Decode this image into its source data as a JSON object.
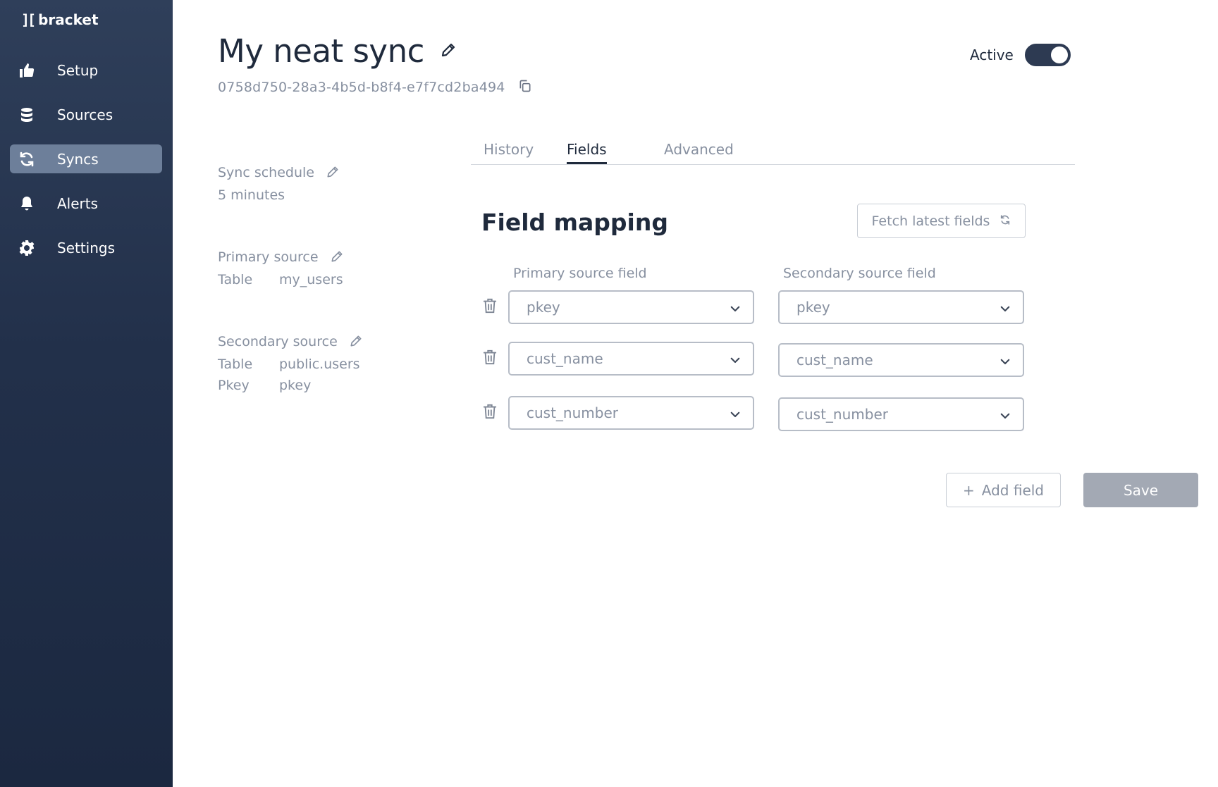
{
  "app": {
    "logo_mark": "][",
    "logo_text": "bracket"
  },
  "sidebar": {
    "items": [
      {
        "label": "Setup",
        "icon": "thumbs-up-icon",
        "active": false
      },
      {
        "label": "Sources",
        "icon": "database-icon",
        "active": false
      },
      {
        "label": "Syncs",
        "icon": "sync-icon",
        "active": true
      },
      {
        "label": "Alerts",
        "icon": "bell-icon",
        "active": false
      },
      {
        "label": "Settings",
        "icon": "gear-icon",
        "active": false
      }
    ]
  },
  "header": {
    "title": "My neat sync",
    "sync_id": "0758d750-28a3-4b5d-b8f4-e7f7cd2ba494",
    "active_label": "Active",
    "active": true
  },
  "details": {
    "schedule_label": "Sync schedule",
    "schedule_value": "5 minutes",
    "primary_label": "Primary source",
    "primary_table_key": "Table",
    "primary_table_value": "my_users",
    "secondary_label": "Secondary source",
    "secondary_table_key": "Table",
    "secondary_table_value": "public.users",
    "secondary_pkey_key": "Pkey",
    "secondary_pkey_value": "pkey"
  },
  "tabs": [
    {
      "label": "History",
      "active": false
    },
    {
      "label": "Fields",
      "active": true
    },
    {
      "label": "Advanced",
      "active": false
    }
  ],
  "field_mapping": {
    "title": "Field mapping",
    "fetch_label": "Fetch latest fields",
    "primary_header": "Primary source field",
    "secondary_header": "Secondary source field",
    "rows": [
      {
        "primary": "pkey",
        "secondary": "pkey"
      },
      {
        "primary": "cust_name",
        "secondary": "cust_name"
      },
      {
        "primary": "cust_number",
        "secondary": "cust_number"
      }
    ],
    "add_label": "Add field",
    "add_prefix": "+",
    "save_label": "Save"
  },
  "colors": {
    "sidebar_bg": "#22304a",
    "active_nav": "#6d7f9a",
    "text_dark": "#1f2a3c",
    "text_muted": "#8790a0",
    "save_disabled": "#a3a9b4"
  }
}
